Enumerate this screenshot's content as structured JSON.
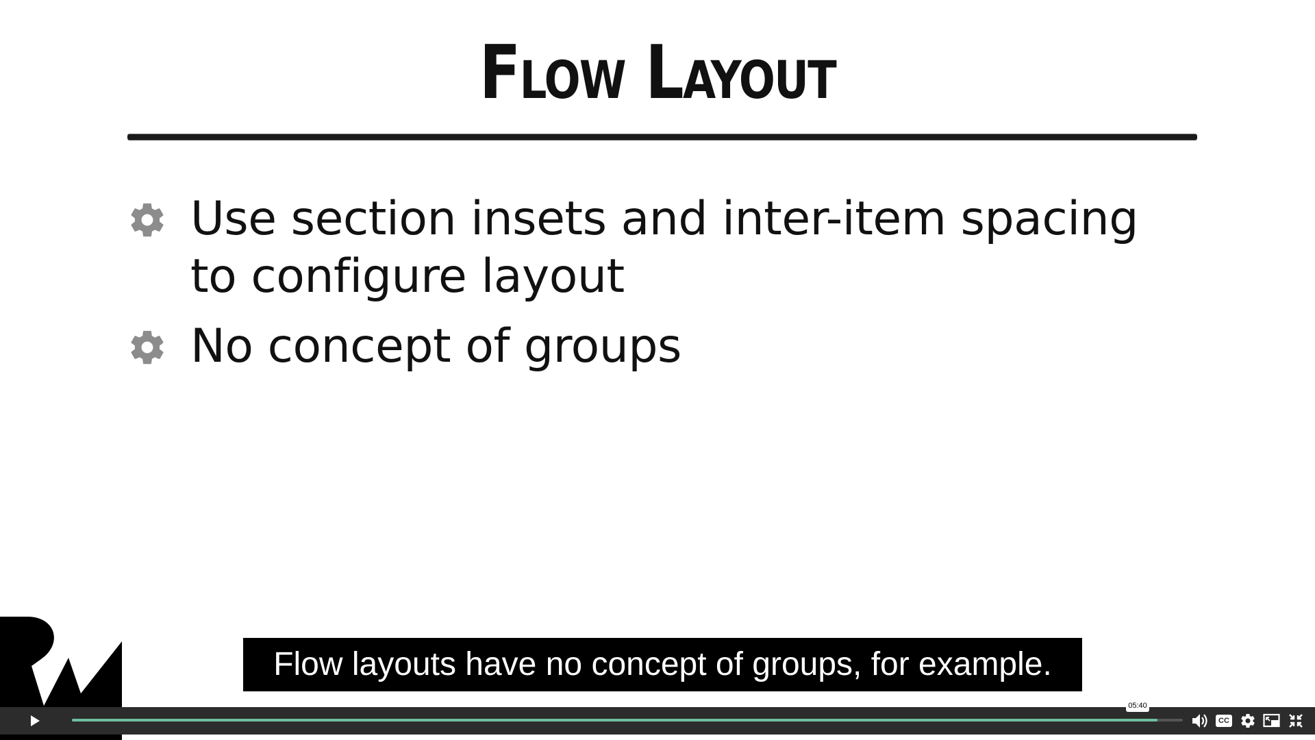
{
  "slide": {
    "title": "Flow Layout",
    "bullets": [
      {
        "text": "Use section insets and inter-item spacing to configure layout",
        "icon": "gear-icon"
      },
      {
        "text": "No concept of groups",
        "icon": "gear-icon"
      }
    ]
  },
  "caption": {
    "text": "Flow layouts have no concept of groups, for example."
  },
  "player": {
    "progress_fraction": 0.977,
    "time_tooltip": "05:40",
    "icons": [
      "play-icon",
      "volume-icon",
      "cc-icon",
      "gear-icon",
      "picture-in-picture-icon",
      "exit-fullscreen-icon"
    ],
    "cc_label": "CC",
    "colors": {
      "progress": "#6fbf9f",
      "bar": "#2c2c2c",
      "accent_logo": "#000000"
    }
  }
}
